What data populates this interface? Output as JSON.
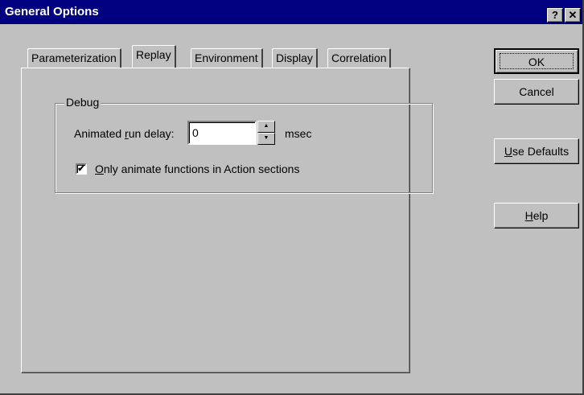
{
  "window": {
    "title": "General Options",
    "help_button": "?",
    "close_button": "✕"
  },
  "tabs": [
    {
      "label": "Parameterization",
      "selected": false
    },
    {
      "label": "Replay",
      "selected": true
    },
    {
      "label": "Environment",
      "selected": false
    },
    {
      "label": "Display",
      "selected": false
    },
    {
      "label": "Correlation",
      "selected": false
    }
  ],
  "debug_group": {
    "legend": "Debug",
    "delay_label_before": "Animated ",
    "delay_label_mnemonic": "r",
    "delay_label_after": "un delay:",
    "delay_value": "0",
    "delay_unit": "msec",
    "checkbox_checked_glyph": "✔",
    "checkbox_mnemonic": "O",
    "checkbox_label_rest": "nly animate functions in Action sections",
    "checkbox_checked": true
  },
  "buttons": {
    "ok": "OK",
    "cancel": "Cancel",
    "use_defaults_mnemonic": "U",
    "use_defaults_rest": "se Defaults",
    "help_mnemonic": "H",
    "help_rest": "elp"
  }
}
